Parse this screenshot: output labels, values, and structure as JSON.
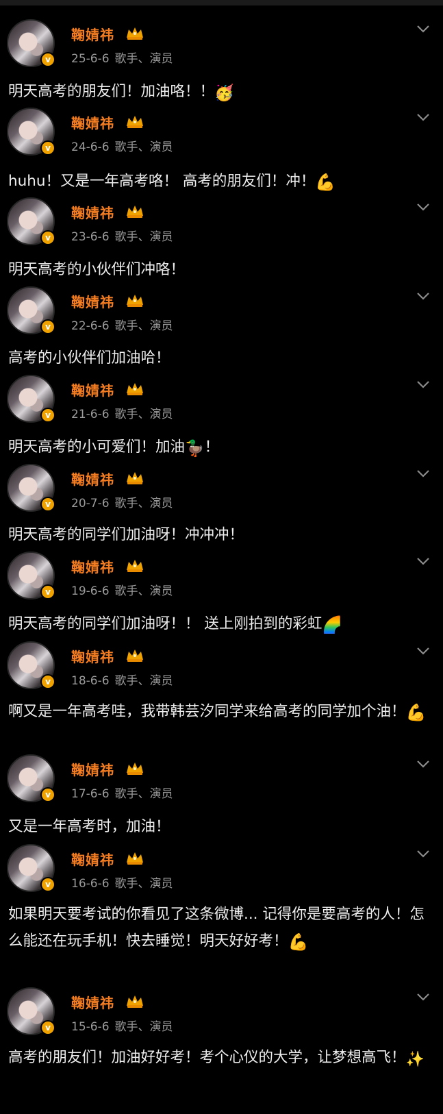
{
  "account": {
    "name": "鞠婧祎",
    "badge_icon": "crown-icon",
    "verified_icon": "v-verified-icon",
    "accent_color": "#f57d22",
    "verified_color": "#f0a300"
  },
  "posts": [
    {
      "date": "25-6-6",
      "source": "歌手、演员",
      "text": "明天高考的朋友们！加油咯！！",
      "emoji": "🥳",
      "emoji_name": "partying-face-icon"
    },
    {
      "date": "24-6-6",
      "source": "歌手、演员",
      "text": "huhu！又是一年高考咯！ 高考的朋友们！冲！",
      "emoji": "💪",
      "emoji_name": "flexed-biceps-icon"
    },
    {
      "date": "23-6-6",
      "source": "歌手、演员",
      "text": "明天高考的小伙伴们冲咯！",
      "emoji": "",
      "emoji_name": ""
    },
    {
      "date": "22-6-6",
      "source": "歌手、演员",
      "text": "高考的小伙伴们加油哈！",
      "emoji": "",
      "emoji_name": ""
    },
    {
      "date": "21-6-6",
      "source": "歌手、演员",
      "text": "明天高考的小可爱们！加油",
      "emoji": "🦆",
      "emoji_name": "duck-icon",
      "text_after": "！"
    },
    {
      "date": "20-7-6",
      "source": "歌手、演员",
      "text": "明天高考的同学们加油呀！冲冲冲！",
      "emoji": "",
      "emoji_name": ""
    },
    {
      "date": "19-6-6",
      "source": "歌手、演员",
      "text": "明天高考的同学们加油呀！！ 送上刚拍到的彩虹",
      "emoji": "🌈",
      "emoji_name": "rainbow-icon"
    },
    {
      "date": "18-6-6",
      "source": "歌手、演员",
      "text": "啊又是一年高考哇，我带韩芸汐同学来给高考的同学加个油！",
      "emoji": "💪",
      "emoji_name": "flexed-biceps-icon"
    },
    {
      "date": "17-6-6",
      "source": "歌手、演员",
      "text": "又是一年高考时，加油！",
      "emoji": "",
      "emoji_name": ""
    },
    {
      "date": "16-6-6",
      "source": "歌手、演员",
      "text": "如果明天要考试的你看见了这条微博... 记得你是要高考的人！怎么能还在玩手机！快去睡觉！明天好好考！",
      "emoji": "💪",
      "emoji_name": "flexed-biceps-icon"
    },
    {
      "date": "15-6-6",
      "source": "歌手、演员",
      "text": "高考的朋友们！加油好好考！考个心仪的大学，让梦想高飞！",
      "emoji": "✨",
      "emoji_name": "sparkles-icon"
    }
  ]
}
